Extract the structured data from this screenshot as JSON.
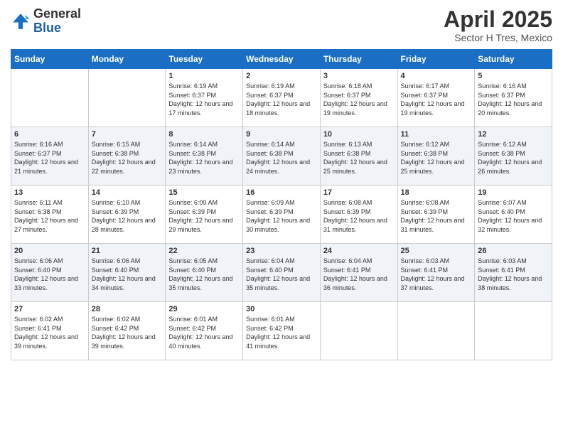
{
  "header": {
    "logo_general": "General",
    "logo_blue": "Blue",
    "title": "April 2025",
    "location": "Sector H Tres, Mexico"
  },
  "days_of_week": [
    "Sunday",
    "Monday",
    "Tuesday",
    "Wednesday",
    "Thursday",
    "Friday",
    "Saturday"
  ],
  "weeks": [
    [
      {
        "day": "",
        "sunrise": "",
        "sunset": "",
        "daylight": ""
      },
      {
        "day": "",
        "sunrise": "",
        "sunset": "",
        "daylight": ""
      },
      {
        "day": "1",
        "sunrise": "Sunrise: 6:19 AM",
        "sunset": "Sunset: 6:37 PM",
        "daylight": "Daylight: 12 hours and 17 minutes."
      },
      {
        "day": "2",
        "sunrise": "Sunrise: 6:19 AM",
        "sunset": "Sunset: 6:37 PM",
        "daylight": "Daylight: 12 hours and 18 minutes."
      },
      {
        "day": "3",
        "sunrise": "Sunrise: 6:18 AM",
        "sunset": "Sunset: 6:37 PM",
        "daylight": "Daylight: 12 hours and 19 minutes."
      },
      {
        "day": "4",
        "sunrise": "Sunrise: 6:17 AM",
        "sunset": "Sunset: 6:37 PM",
        "daylight": "Daylight: 12 hours and 19 minutes."
      },
      {
        "day": "5",
        "sunrise": "Sunrise: 6:16 AM",
        "sunset": "Sunset: 6:37 PM",
        "daylight": "Daylight: 12 hours and 20 minutes."
      }
    ],
    [
      {
        "day": "6",
        "sunrise": "Sunrise: 6:16 AM",
        "sunset": "Sunset: 6:37 PM",
        "daylight": "Daylight: 12 hours and 21 minutes."
      },
      {
        "day": "7",
        "sunrise": "Sunrise: 6:15 AM",
        "sunset": "Sunset: 6:38 PM",
        "daylight": "Daylight: 12 hours and 22 minutes."
      },
      {
        "day": "8",
        "sunrise": "Sunrise: 6:14 AM",
        "sunset": "Sunset: 6:38 PM",
        "daylight": "Daylight: 12 hours and 23 minutes."
      },
      {
        "day": "9",
        "sunrise": "Sunrise: 6:14 AM",
        "sunset": "Sunset: 6:38 PM",
        "daylight": "Daylight: 12 hours and 24 minutes."
      },
      {
        "day": "10",
        "sunrise": "Sunrise: 6:13 AM",
        "sunset": "Sunset: 6:38 PM",
        "daylight": "Daylight: 12 hours and 25 minutes."
      },
      {
        "day": "11",
        "sunrise": "Sunrise: 6:12 AM",
        "sunset": "Sunset: 6:38 PM",
        "daylight": "Daylight: 12 hours and 25 minutes."
      },
      {
        "day": "12",
        "sunrise": "Sunrise: 6:12 AM",
        "sunset": "Sunset: 6:38 PM",
        "daylight": "Daylight: 12 hours and 26 minutes."
      }
    ],
    [
      {
        "day": "13",
        "sunrise": "Sunrise: 6:11 AM",
        "sunset": "Sunset: 6:38 PM",
        "daylight": "Daylight: 12 hours and 27 minutes."
      },
      {
        "day": "14",
        "sunrise": "Sunrise: 6:10 AM",
        "sunset": "Sunset: 6:39 PM",
        "daylight": "Daylight: 12 hours and 28 minutes."
      },
      {
        "day": "15",
        "sunrise": "Sunrise: 6:09 AM",
        "sunset": "Sunset: 6:39 PM",
        "daylight": "Daylight: 12 hours and 29 minutes."
      },
      {
        "day": "16",
        "sunrise": "Sunrise: 6:09 AM",
        "sunset": "Sunset: 6:39 PM",
        "daylight": "Daylight: 12 hours and 30 minutes."
      },
      {
        "day": "17",
        "sunrise": "Sunrise: 6:08 AM",
        "sunset": "Sunset: 6:39 PM",
        "daylight": "Daylight: 12 hours and 31 minutes."
      },
      {
        "day": "18",
        "sunrise": "Sunrise: 6:08 AM",
        "sunset": "Sunset: 6:39 PM",
        "daylight": "Daylight: 12 hours and 31 minutes."
      },
      {
        "day": "19",
        "sunrise": "Sunrise: 6:07 AM",
        "sunset": "Sunset: 6:40 PM",
        "daylight": "Daylight: 12 hours and 32 minutes."
      }
    ],
    [
      {
        "day": "20",
        "sunrise": "Sunrise: 6:06 AM",
        "sunset": "Sunset: 6:40 PM",
        "daylight": "Daylight: 12 hours and 33 minutes."
      },
      {
        "day": "21",
        "sunrise": "Sunrise: 6:06 AM",
        "sunset": "Sunset: 6:40 PM",
        "daylight": "Daylight: 12 hours and 34 minutes."
      },
      {
        "day": "22",
        "sunrise": "Sunrise: 6:05 AM",
        "sunset": "Sunset: 6:40 PM",
        "daylight": "Daylight: 12 hours and 35 minutes."
      },
      {
        "day": "23",
        "sunrise": "Sunrise: 6:04 AM",
        "sunset": "Sunset: 6:40 PM",
        "daylight": "Daylight: 12 hours and 35 minutes."
      },
      {
        "day": "24",
        "sunrise": "Sunrise: 6:04 AM",
        "sunset": "Sunset: 6:41 PM",
        "daylight": "Daylight: 12 hours and 36 minutes."
      },
      {
        "day": "25",
        "sunrise": "Sunrise: 6:03 AM",
        "sunset": "Sunset: 6:41 PM",
        "daylight": "Daylight: 12 hours and 37 minutes."
      },
      {
        "day": "26",
        "sunrise": "Sunrise: 6:03 AM",
        "sunset": "Sunset: 6:41 PM",
        "daylight": "Daylight: 12 hours and 38 minutes."
      }
    ],
    [
      {
        "day": "27",
        "sunrise": "Sunrise: 6:02 AM",
        "sunset": "Sunset: 6:41 PM",
        "daylight": "Daylight: 12 hours and 39 minutes."
      },
      {
        "day": "28",
        "sunrise": "Sunrise: 6:02 AM",
        "sunset": "Sunset: 6:42 PM",
        "daylight": "Daylight: 12 hours and 39 minutes."
      },
      {
        "day": "29",
        "sunrise": "Sunrise: 6:01 AM",
        "sunset": "Sunset: 6:42 PM",
        "daylight": "Daylight: 12 hours and 40 minutes."
      },
      {
        "day": "30",
        "sunrise": "Sunrise: 6:01 AM",
        "sunset": "Sunset: 6:42 PM",
        "daylight": "Daylight: 12 hours and 41 minutes."
      },
      {
        "day": "",
        "sunrise": "",
        "sunset": "",
        "daylight": ""
      },
      {
        "day": "",
        "sunrise": "",
        "sunset": "",
        "daylight": ""
      },
      {
        "day": "",
        "sunrise": "",
        "sunset": "",
        "daylight": ""
      }
    ]
  ]
}
